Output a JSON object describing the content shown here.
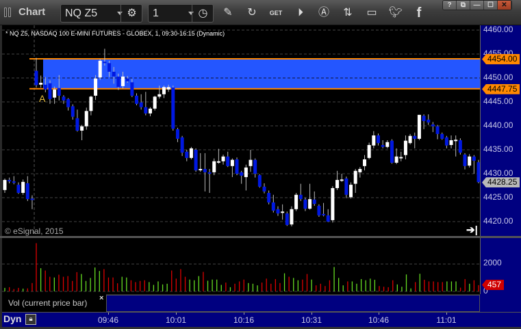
{
  "window": {
    "title": "Chart",
    "symbol": "NQ Z5",
    "interval": "1",
    "window_buttons": [
      "?",
      "⧉",
      "—",
      "☐",
      "✕"
    ]
  },
  "toolbar": {
    "icons": [
      "gear-icon",
      "clock-icon",
      "pencil-icon",
      "refresh-icon",
      "get-icon",
      "play-icon",
      "alert-icon",
      "swap-icon",
      "comment-icon",
      "twitter-icon",
      "facebook-icon"
    ],
    "get_label": "GET"
  },
  "chart": {
    "header": "* NQ Z5, NASDAQ 100 E-MINI FUTURES - GLOBEX, 1, 09:30-16:15 (Dynamic)",
    "copyright": "© eSignal, 2015",
    "marker_label": "A",
    "price_labels": [
      "4460.00",
      "4455.00",
      "4450.00",
      "4445.00",
      "4440.00",
      "4435.00",
      "4430.00",
      "4425.00",
      "4420.00"
    ],
    "band_top": "4454.00",
    "band_bottom": "4447.75",
    "last_price": "4428.25",
    "colors": {
      "band": "#2456ff",
      "band_line": "#ff8800",
      "up": "#ffffff",
      "down": "#0018e0",
      "vol_up": "#66dd22",
      "vol_down": "#e00000",
      "axis_bg": "#000080"
    }
  },
  "chart_data": {
    "type": "candlestick",
    "ylim": [
      4418,
      4462
    ],
    "price_ticks": [
      4460,
      4455,
      4450,
      4445,
      4440,
      4435,
      4430,
      4425,
      4420
    ],
    "band": [
      4447.75,
      4454.0
    ],
    "presession_ohlc": [
      [
        4426.6,
        4429.0,
        4426.0,
        4428.7
      ],
      [
        4428.7,
        4429.2,
        4428.0,
        4428.4
      ],
      [
        4428.4,
        4429.5,
        4427.8,
        4428.2
      ],
      [
        4427.7,
        4428.2,
        4425.8,
        4426.0
      ],
      [
        4426.0,
        4428.8,
        4425.6,
        4428.3
      ],
      [
        4428.0,
        4429.5,
        4424.3,
        4424.7
      ],
      [
        4424.8,
        4425.5,
        4422.6,
        4424.6
      ]
    ],
    "session_ohlc": [
      [
        4451.5,
        4454.2,
        4448.0,
        4448.5
      ],
      [
        4448.6,
        4450.5,
        4448.0,
        4449.0
      ],
      [
        4448.6,
        4450.2,
        4447.0,
        4447.6
      ],
      [
        4448.9,
        4449.5,
        4444.6,
        4445.6
      ],
      [
        4445.9,
        4448.2,
        4444.6,
        4447.6
      ],
      [
        4447.9,
        4450.6,
        4445.3,
        4446.3
      ],
      [
        4446.1,
        4446.4,
        4444.6,
        4445.3
      ],
      [
        4445.6,
        4445.8,
        4443.2,
        4443.9
      ],
      [
        4444.1,
        4444.5,
        4441.3,
        4441.9
      ],
      [
        4441.6,
        4443.4,
        4438.8,
        4439.0
      ],
      [
        4439.0,
        4440.2,
        4437.0,
        4439.9
      ],
      [
        4439.9,
        4443.8,
        4439.2,
        4443.1
      ],
      [
        4443.1,
        4446.3,
        4442.2,
        4446.1
      ],
      [
        4446.3,
        4450.6,
        4445.4,
        4449.9
      ],
      [
        4450.1,
        4454.0,
        4449.6,
        4453.6
      ],
      [
        4453.4,
        4456.1,
        4452.6,
        4453.1
      ],
      [
        4453.1,
        4453.6,
        4450.2,
        4451.3
      ],
      [
        4451.3,
        4452.3,
        4448.8,
        4450.3
      ],
      [
        4450.3,
        4450.9,
        4447.5,
        4448.1
      ],
      [
        4448.3,
        4451.3,
        4447.8,
        4450.3
      ],
      [
        4449.9,
        4450.4,
        4449.0,
        4449.3
      ],
      [
        4449.1,
        4449.8,
        4446.0,
        4446.3
      ],
      [
        4446.3,
        4446.8,
        4444.3,
        4444.6
      ],
      [
        4444.9,
        4446.6,
        4443.4,
        4443.9
      ],
      [
        4443.9,
        4447.1,
        4442.2,
        4442.6
      ],
      [
        4442.6,
        4443.9,
        4442.0,
        4443.6
      ],
      [
        4443.6,
        4446.3,
        4443.2,
        4446.1
      ],
      [
        4446.1,
        4448.4,
        4445.7,
        4446.6
      ],
      [
        4446.6,
        4448.4,
        4445.8,
        4448.1
      ],
      [
        4447.6,
        4448.6,
        4447.1,
        4448.1
      ],
      [
        4448.0,
        4448.4,
        4439.0,
        4439.4
      ],
      [
        4439.3,
        4439.6,
        4436.6,
        4437.3
      ],
      [
        4437.6,
        4437.9,
        4433.7,
        4434.4
      ],
      [
        4434.6,
        4435.0,
        4432.6,
        4433.3
      ],
      [
        4433.3,
        4435.6,
        4433.0,
        4435.3
      ],
      [
        4435.0,
        4435.3,
        4430.4,
        4430.7
      ],
      [
        4430.8,
        4434.3,
        4430.4,
        4431.0
      ],
      [
        4431.0,
        4434.3,
        4426.3,
        4430.3
      ],
      [
        4430.3,
        4431.0,
        4426.0,
        4430.1
      ],
      [
        4430.3,
        4433.2,
        4429.7,
        4432.6
      ],
      [
        4432.4,
        4435.2,
        4432.1,
        4432.6
      ],
      [
        4432.6,
        4434.0,
        4431.9,
        4433.6
      ],
      [
        4433.6,
        4434.6,
        4431.4,
        4431.6
      ],
      [
        4431.6,
        4433.2,
        4429.3,
        4432.9
      ],
      [
        4433.0,
        4433.4,
        4429.7,
        4430.0
      ],
      [
        4430.3,
        4430.6,
        4427.9,
        4429.6
      ],
      [
        4429.3,
        4431.9,
        4426.5,
        4431.3
      ],
      [
        4431.6,
        4435.0,
        4430.4,
        4432.9
      ],
      [
        4432.9,
        4433.2,
        4429.2,
        4430.0
      ],
      [
        4429.7,
        4429.9,
        4427.1,
        4427.3
      ],
      [
        4427.3,
        4428.0,
        4425.9,
        4426.3
      ],
      [
        4426.0,
        4426.5,
        4423.6,
        4424.0
      ],
      [
        4424.0,
        4425.6,
        4421.9,
        4422.3
      ],
      [
        4422.6,
        4423.2,
        4421.2,
        4421.7
      ],
      [
        4421.9,
        4423.6,
        4420.4,
        4422.1
      ],
      [
        4421.7,
        4422.1,
        4419.1,
        4419.3
      ],
      [
        4419.4,
        4423.2,
        4419.0,
        4422.6
      ],
      [
        4422.6,
        4426.0,
        4422.2,
        4425.6
      ],
      [
        4425.6,
        4427.9,
        4424.3,
        4424.7
      ],
      [
        4424.6,
        4425.0,
        4422.2,
        4422.7
      ],
      [
        4422.7,
        4427.9,
        4422.5,
        4424.7
      ],
      [
        4424.6,
        4426.3,
        4423.3,
        4423.7
      ],
      [
        4423.3,
        4423.6,
        4421.0,
        4421.3
      ],
      [
        4421.6,
        4423.9,
        4421.1,
        4421.4
      ],
      [
        4421.3,
        4422.6,
        4419.9,
        4420.0
      ],
      [
        4420.3,
        4427.4,
        4419.8,
        4427.0
      ],
      [
        4427.0,
        4430.6,
        4426.6,
        4428.7
      ],
      [
        4428.6,
        4430.0,
        4428.3,
        4428.8
      ],
      [
        4429.0,
        4429.4,
        4424.9,
        4425.6
      ],
      [
        4425.1,
        4428.2,
        4424.8,
        4427.7
      ],
      [
        4427.9,
        4431.0,
        4426.0,
        4430.6
      ],
      [
        4430.3,
        4431.4,
        4429.2,
        4431.0
      ],
      [
        4431.6,
        4433.9,
        4430.7,
        4433.0
      ],
      [
        4433.3,
        4436.5,
        4433.0,
        4436.0
      ],
      [
        4435.9,
        4438.9,
        4435.3,
        4438.0
      ],
      [
        4438.0,
        4438.4,
        4435.9,
        4436.4
      ],
      [
        4436.0,
        4437.0,
        4435.3,
        4435.6
      ],
      [
        4435.6,
        4437.0,
        4435.3,
        4436.6
      ],
      [
        4436.9,
        4437.2,
        4432.1,
        4432.3
      ],
      [
        4432.3,
        4435.3,
        4432.0,
        4433.6
      ],
      [
        4433.3,
        4434.6,
        4432.6,
        4433.5
      ],
      [
        4433.9,
        4438.0,
        4433.0,
        4436.9
      ],
      [
        4436.4,
        4438.3,
        4436.1,
        4437.9
      ],
      [
        4437.9,
        4438.6,
        4435.3,
        4437.3
      ],
      [
        4437.3,
        4442.3,
        4437.0,
        4442.3
      ],
      [
        4442.1,
        4442.4,
        4439.3,
        4441.0
      ],
      [
        4441.3,
        4442.4,
        4440.2,
        4440.7
      ],
      [
        4440.3,
        4440.8,
        4438.7,
        4439.9
      ],
      [
        4439.9,
        4440.2,
        4437.2,
        4438.3
      ],
      [
        4438.3,
        4438.6,
        4437.1,
        4437.3
      ],
      [
        4437.6,
        4437.9,
        4435.3,
        4435.9
      ],
      [
        4436.0,
        4438.0,
        4435.3,
        4437.0
      ],
      [
        4436.9,
        4438.0,
        4433.6,
        4437.1
      ],
      [
        4437.0,
        4437.4,
        4434.0,
        4434.4
      ],
      [
        4434.0,
        4434.3,
        4430.9,
        4431.6
      ],
      [
        4431.7,
        4434.1,
        4431.3,
        4433.6
      ],
      [
        4433.6,
        4433.9,
        4430.0,
        4432.7
      ],
      [
        4432.4,
        4432.9,
        4428.0,
        4428.25
      ]
    ],
    "volume": {
      "label": "Vol (current price bar)",
      "ticks": [
        "2000",
        "0"
      ],
      "last": "457",
      "ylim": [
        0,
        3600
      ],
      "presession": [
        [
          254,
          "up"
        ],
        [
          305,
          "down"
        ],
        [
          169,
          "down"
        ],
        [
          254,
          "down"
        ],
        [
          203,
          "up"
        ],
        [
          220,
          "down"
        ],
        [
          610,
          "down"
        ]
      ],
      "session": [
        [
          3525,
          "down"
        ],
        [
          1695,
          "up"
        ],
        [
          1525,
          "down"
        ],
        [
          1068,
          "down"
        ],
        [
          1017,
          "up"
        ],
        [
          1220,
          "down"
        ],
        [
          1068,
          "down"
        ],
        [
          1118,
          "down"
        ],
        [
          763,
          "down"
        ],
        [
          1407,
          "down"
        ],
        [
          1271,
          "up"
        ],
        [
          763,
          "up"
        ],
        [
          983,
          "up"
        ],
        [
          1746,
          "up"
        ],
        [
          1491,
          "up"
        ],
        [
          1627,
          "down"
        ],
        [
          1017,
          "down"
        ],
        [
          1017,
          "down"
        ],
        [
          593,
          "down"
        ],
        [
          1068,
          "up"
        ],
        [
          1017,
          "up"
        ],
        [
          813,
          "down"
        ],
        [
          678,
          "down"
        ],
        [
          763,
          "down"
        ],
        [
          813,
          "down"
        ],
        [
          678,
          "up"
        ],
        [
          475,
          "up"
        ],
        [
          729,
          "up"
        ],
        [
          508,
          "up"
        ],
        [
          559,
          "up"
        ],
        [
          1525,
          "down"
        ],
        [
          932,
          "down"
        ],
        [
          1627,
          "down"
        ],
        [
          1068,
          "down"
        ],
        [
          864,
          "up"
        ],
        [
          813,
          "up"
        ],
        [
          1118,
          "up"
        ],
        [
          1424,
          "down"
        ],
        [
          780,
          "up"
        ],
        [
          864,
          "up"
        ],
        [
          864,
          "up"
        ],
        [
          475,
          "up"
        ],
        [
          644,
          "down"
        ],
        [
          305,
          "up"
        ],
        [
          559,
          "down"
        ],
        [
          729,
          "down"
        ],
        [
          864,
          "down"
        ],
        [
          610,
          "up"
        ],
        [
          559,
          "up"
        ],
        [
          441,
          "up"
        ],
        [
          644,
          "down"
        ],
        [
          932,
          "down"
        ],
        [
          559,
          "down"
        ],
        [
          898,
          "down"
        ],
        [
          610,
          "down"
        ],
        [
          1322,
          "up"
        ],
        [
          1068,
          "down"
        ],
        [
          983,
          "up"
        ],
        [
          813,
          "up"
        ],
        [
          864,
          "down"
        ],
        [
          1271,
          "down"
        ],
        [
          864,
          "up"
        ],
        [
          441,
          "down"
        ],
        [
          559,
          "down"
        ],
        [
          390,
          "down"
        ],
        [
          813,
          "down"
        ],
        [
          1780,
          "up"
        ],
        [
          983,
          "up"
        ],
        [
          441,
          "up"
        ],
        [
          729,
          "down"
        ],
        [
          729,
          "up"
        ],
        [
          559,
          "up"
        ],
        [
          898,
          "up"
        ],
        [
          813,
          "up"
        ],
        [
          932,
          "up"
        ],
        [
          847,
          "up"
        ],
        [
          390,
          "down"
        ],
        [
          339,
          "down"
        ],
        [
          305,
          "down"
        ],
        [
          813,
          "down"
        ],
        [
          508,
          "up"
        ],
        [
          339,
          "up"
        ],
        [
          1237,
          "up"
        ],
        [
          220,
          "up"
        ],
        [
          678,
          "down"
        ],
        [
          1288,
          "up"
        ],
        [
          847,
          "down"
        ],
        [
          729,
          "down"
        ],
        [
          729,
          "down"
        ],
        [
          678,
          "down"
        ],
        [
          678,
          "down"
        ],
        [
          729,
          "up"
        ],
        [
          729,
          "up"
        ],
        [
          729,
          "up"
        ],
        [
          271,
          "down"
        ],
        [
          898,
          "down"
        ],
        [
          559,
          "up"
        ],
        [
          813,
          "down"
        ],
        [
          457,
          "down"
        ]
      ]
    },
    "time_labels": [
      "09:46",
      "10:01",
      "10:16",
      "10:31",
      "10:46",
      "11:01"
    ]
  },
  "footer": {
    "mode": "Dyn",
    "close_label": "×"
  }
}
